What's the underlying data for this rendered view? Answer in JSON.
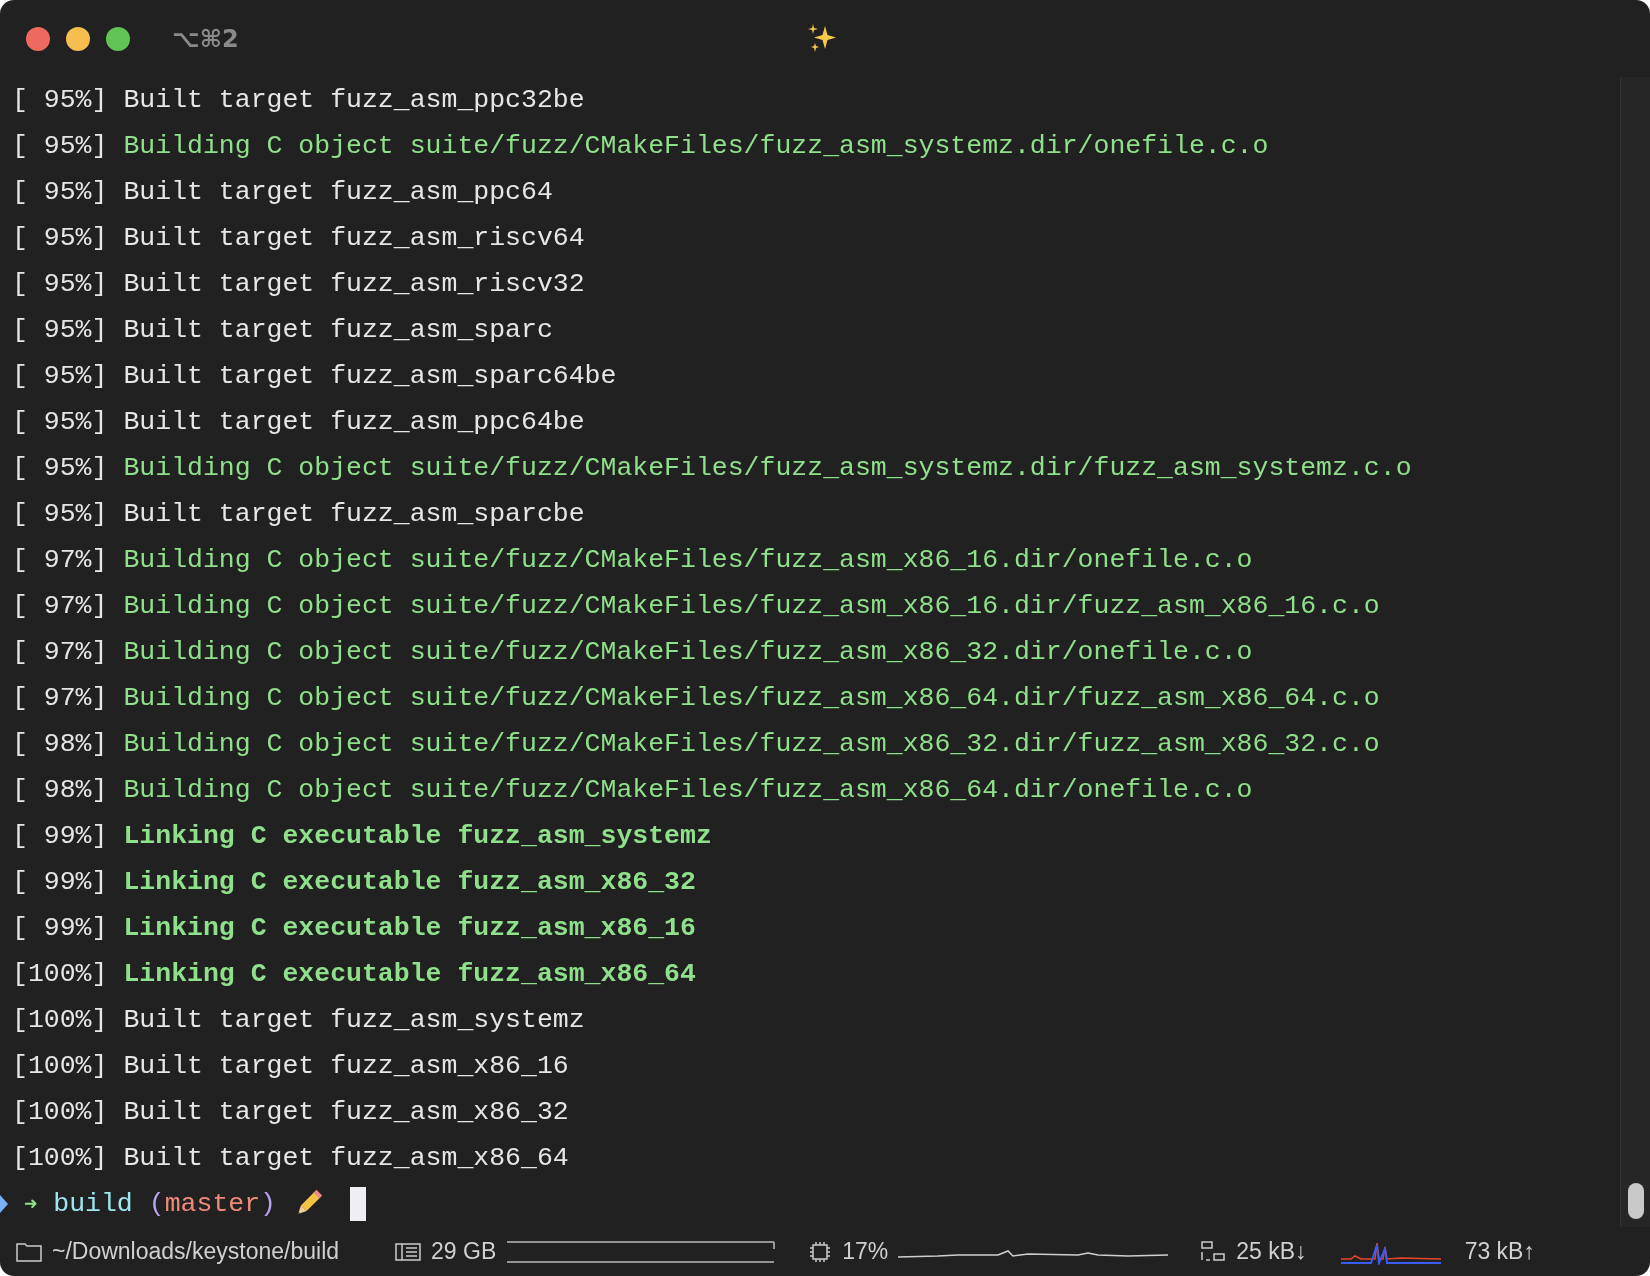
{
  "window": {
    "title": "⌥⌘2"
  },
  "lines": [
    {
      "progress": "[ 95%]",
      "kind": "built",
      "text": "Built target fuzz_asm_ppc32be"
    },
    {
      "progress": "[ 95%]",
      "kind": "building",
      "text": "Building C object suite/fuzz/CMakeFiles/fuzz_asm_systemz.dir/onefile.c.o"
    },
    {
      "progress": "[ 95%]",
      "kind": "built",
      "text": "Built target fuzz_asm_ppc64"
    },
    {
      "progress": "[ 95%]",
      "kind": "built",
      "text": "Built target fuzz_asm_riscv64"
    },
    {
      "progress": "[ 95%]",
      "kind": "built",
      "text": "Built target fuzz_asm_riscv32"
    },
    {
      "progress": "[ 95%]",
      "kind": "built",
      "text": "Built target fuzz_asm_sparc"
    },
    {
      "progress": "[ 95%]",
      "kind": "built",
      "text": "Built target fuzz_asm_sparc64be"
    },
    {
      "progress": "[ 95%]",
      "kind": "built",
      "text": "Built target fuzz_asm_ppc64be"
    },
    {
      "progress": "[ 95%]",
      "kind": "building",
      "text": "Building C object suite/fuzz/CMakeFiles/fuzz_asm_systemz.dir/fuzz_asm_systemz.c.o"
    },
    {
      "progress": "[ 95%]",
      "kind": "built",
      "text": "Built target fuzz_asm_sparcbe"
    },
    {
      "progress": "[ 97%]",
      "kind": "building",
      "text": "Building C object suite/fuzz/CMakeFiles/fuzz_asm_x86_16.dir/onefile.c.o"
    },
    {
      "progress": "[ 97%]",
      "kind": "building",
      "text": "Building C object suite/fuzz/CMakeFiles/fuzz_asm_x86_16.dir/fuzz_asm_x86_16.c.o"
    },
    {
      "progress": "[ 97%]",
      "kind": "building",
      "text": "Building C object suite/fuzz/CMakeFiles/fuzz_asm_x86_32.dir/onefile.c.o"
    },
    {
      "progress": "[ 97%]",
      "kind": "building",
      "text": "Building C object suite/fuzz/CMakeFiles/fuzz_asm_x86_64.dir/fuzz_asm_x86_64.c.o"
    },
    {
      "progress": "[ 98%]",
      "kind": "building",
      "text": "Building C object suite/fuzz/CMakeFiles/fuzz_asm_x86_32.dir/fuzz_asm_x86_32.c.o"
    },
    {
      "progress": "[ 98%]",
      "kind": "building",
      "text": "Building C object suite/fuzz/CMakeFiles/fuzz_asm_x86_64.dir/onefile.c.o"
    },
    {
      "progress": "[ 99%]",
      "kind": "linking",
      "text": "Linking C executable fuzz_asm_systemz"
    },
    {
      "progress": "[ 99%]",
      "kind": "linking",
      "text": "Linking C executable fuzz_asm_x86_32"
    },
    {
      "progress": "[ 99%]",
      "kind": "linking",
      "text": "Linking C executable fuzz_asm_x86_16"
    },
    {
      "progress": "[100%]",
      "kind": "linking",
      "text": "Linking C executable fuzz_asm_x86_64"
    },
    {
      "progress": "[100%]",
      "kind": "built",
      "text": "Built target fuzz_asm_systemz"
    },
    {
      "progress": "[100%]",
      "kind": "built",
      "text": "Built target fuzz_asm_x86_16"
    },
    {
      "progress": "[100%]",
      "kind": "built",
      "text": "Built target fuzz_asm_x86_32"
    },
    {
      "progress": "[100%]",
      "kind": "built",
      "text": "Built target fuzz_asm_x86_64"
    }
  ],
  "prompt": {
    "arrow": "➜",
    "directory": "build",
    "open_paren": "(",
    "branch": "master",
    "close_paren": ")"
  },
  "status_bar": {
    "path": "~/Downloads/keystone/build",
    "memory": "29 GB",
    "cpu": "17%",
    "download": "25 kB↓",
    "upload": "73 kB↑"
  }
}
